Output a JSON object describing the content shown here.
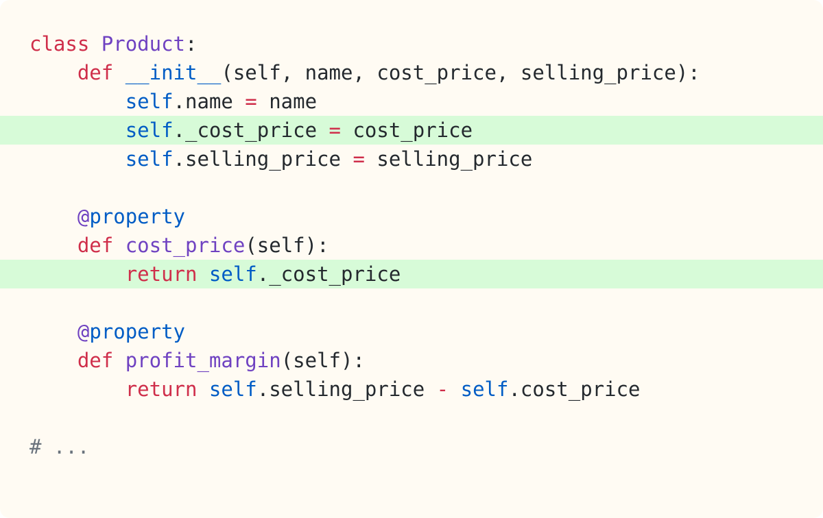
{
  "code": {
    "lines": [
      {
        "highlight": false,
        "tokens": [
          {
            "t": "class",
            "k": "kw"
          },
          {
            "t": " ",
            "k": "plain"
          },
          {
            "t": "Product",
            "k": "cls"
          },
          {
            "t": ":",
            "k": "plain"
          }
        ]
      },
      {
        "highlight": false,
        "tokens": [
          {
            "t": "    ",
            "k": "plain"
          },
          {
            "t": "def",
            "k": "kw"
          },
          {
            "t": " ",
            "k": "plain"
          },
          {
            "t": "__init__",
            "k": "dunder"
          },
          {
            "t": "(self, name, cost_price, selling_price):",
            "k": "plain"
          }
        ]
      },
      {
        "highlight": false,
        "tokens": [
          {
            "t": "        ",
            "k": "plain"
          },
          {
            "t": "self",
            "k": "selfk"
          },
          {
            "t": ".name ",
            "k": "plain"
          },
          {
            "t": "=",
            "k": "op"
          },
          {
            "t": " name",
            "k": "plain"
          }
        ]
      },
      {
        "highlight": true,
        "tokens": [
          {
            "t": "        ",
            "k": "plain"
          },
          {
            "t": "self",
            "k": "selfk"
          },
          {
            "t": "._cost_price ",
            "k": "plain"
          },
          {
            "t": "=",
            "k": "op"
          },
          {
            "t": " cost_price",
            "k": "plain"
          }
        ]
      },
      {
        "highlight": false,
        "tokens": [
          {
            "t": "        ",
            "k": "plain"
          },
          {
            "t": "self",
            "k": "selfk"
          },
          {
            "t": ".selling_price ",
            "k": "plain"
          },
          {
            "t": "=",
            "k": "op"
          },
          {
            "t": " selling_price",
            "k": "plain"
          }
        ]
      },
      {
        "highlight": false,
        "tokens": []
      },
      {
        "highlight": false,
        "tokens": [
          {
            "t": "    ",
            "k": "plain"
          },
          {
            "t": "@",
            "k": "deco-at"
          },
          {
            "t": "property",
            "k": "deco"
          }
        ]
      },
      {
        "highlight": false,
        "tokens": [
          {
            "t": "    ",
            "k": "plain"
          },
          {
            "t": "def",
            "k": "kw"
          },
          {
            "t": " ",
            "k": "plain"
          },
          {
            "t": "cost_price",
            "k": "fn"
          },
          {
            "t": "(self):",
            "k": "plain"
          }
        ]
      },
      {
        "highlight": true,
        "tokens": [
          {
            "t": "        ",
            "k": "plain"
          },
          {
            "t": "return",
            "k": "kw"
          },
          {
            "t": " ",
            "k": "plain"
          },
          {
            "t": "self",
            "k": "selfk"
          },
          {
            "t": "._cost_price",
            "k": "plain"
          }
        ]
      },
      {
        "highlight": false,
        "tokens": []
      },
      {
        "highlight": false,
        "tokens": [
          {
            "t": "    ",
            "k": "plain"
          },
          {
            "t": "@",
            "k": "deco-at"
          },
          {
            "t": "property",
            "k": "deco"
          }
        ]
      },
      {
        "highlight": false,
        "tokens": [
          {
            "t": "    ",
            "k": "plain"
          },
          {
            "t": "def",
            "k": "kw"
          },
          {
            "t": " ",
            "k": "plain"
          },
          {
            "t": "profit_margin",
            "k": "fn"
          },
          {
            "t": "(self):",
            "k": "plain"
          }
        ]
      },
      {
        "highlight": false,
        "tokens": [
          {
            "t": "        ",
            "k": "plain"
          },
          {
            "t": "return",
            "k": "kw"
          },
          {
            "t": " ",
            "k": "plain"
          },
          {
            "t": "self",
            "k": "selfk"
          },
          {
            "t": ".selling_price ",
            "k": "plain"
          },
          {
            "t": "-",
            "k": "op"
          },
          {
            "t": " ",
            "k": "plain"
          },
          {
            "t": "self",
            "k": "selfk"
          },
          {
            "t": ".cost_price",
            "k": "plain"
          }
        ]
      },
      {
        "highlight": false,
        "tokens": []
      },
      {
        "highlight": false,
        "tokens": [
          {
            "t": "# ...",
            "k": "comment"
          }
        ]
      }
    ]
  },
  "theme": {
    "background": "#fffbf3",
    "highlight": "#d7fbd8",
    "keyword": "#cf2e4a",
    "class_name": "#6f42c1",
    "self": "#005cc5",
    "text": "#24292e",
    "comment": "#6a737d"
  }
}
